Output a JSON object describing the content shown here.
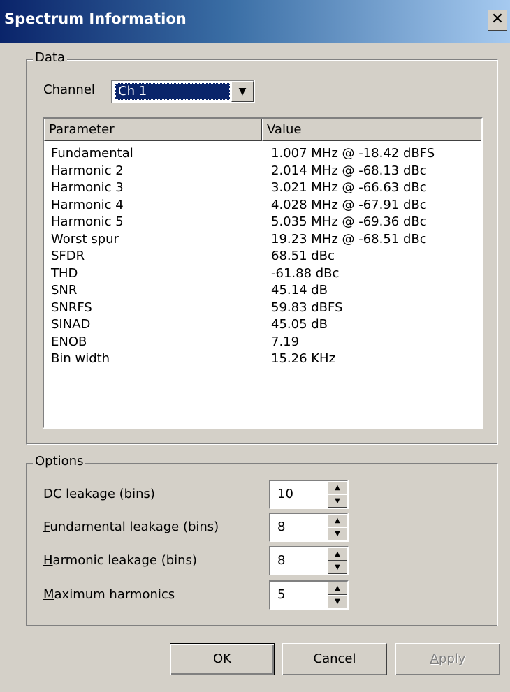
{
  "window": {
    "title": "Spectrum Information",
    "close_glyph": "✕"
  },
  "data_group": {
    "legend": "Data",
    "channel_label": "Channel",
    "channel_selected": "Ch 1"
  },
  "list": {
    "headers": [
      "Parameter",
      "Value"
    ],
    "rows": [
      {
        "param": "Fundamental",
        "value": "1.007 MHz @ -18.42 dBFS"
      },
      {
        "param": "Harmonic 2",
        "value": "2.014 MHz @ -68.13 dBc"
      },
      {
        "param": "Harmonic 3",
        "value": "3.021 MHz @ -66.63 dBc"
      },
      {
        "param": "Harmonic 4",
        "value": "4.028 MHz @ -67.91 dBc"
      },
      {
        "param": "Harmonic 5",
        "value": "5.035 MHz @ -69.36 dBc"
      },
      {
        "param": "Worst spur",
        "value": "19.23 MHz @ -68.51 dBc"
      },
      {
        "param": "SFDR",
        "value": "68.51 dBc"
      },
      {
        "param": "THD",
        "value": "-61.88 dBc"
      },
      {
        "param": "SNR",
        "value": "45.14 dB"
      },
      {
        "param": "SNRFS",
        "value": "59.83 dBFS"
      },
      {
        "param": "SINAD",
        "value": "45.05 dB"
      },
      {
        "param": "ENOB",
        "value": "7.19"
      },
      {
        "param": "Bin width",
        "value": "15.26 KHz"
      }
    ]
  },
  "options_group": {
    "legend": "Options",
    "fields": [
      {
        "mnemonic": "D",
        "rest": "C leakage (bins)",
        "value": "10"
      },
      {
        "mnemonic": "F",
        "rest": "undamental leakage (bins)",
        "value": "8"
      },
      {
        "mnemonic": "H",
        "rest": "armonic leakage (bins)",
        "value": "8"
      },
      {
        "mnemonic": "M",
        "rest": "aximum harmonics",
        "value": "5"
      }
    ]
  },
  "buttons": {
    "ok": "OK",
    "cancel": "Cancel",
    "apply_mnemonic": "A",
    "apply_rest": "pply"
  },
  "icons": {
    "close": "close-icon",
    "dropdown": "chevron-down-icon",
    "spin_up": "arrow-up-icon",
    "spin_down": "arrow-down-icon"
  },
  "colors": {
    "title_gradient_start": "#0a246a",
    "title_gradient_end": "#a6caf0",
    "selection": "#0a246a",
    "face": "#d4d0c8"
  }
}
